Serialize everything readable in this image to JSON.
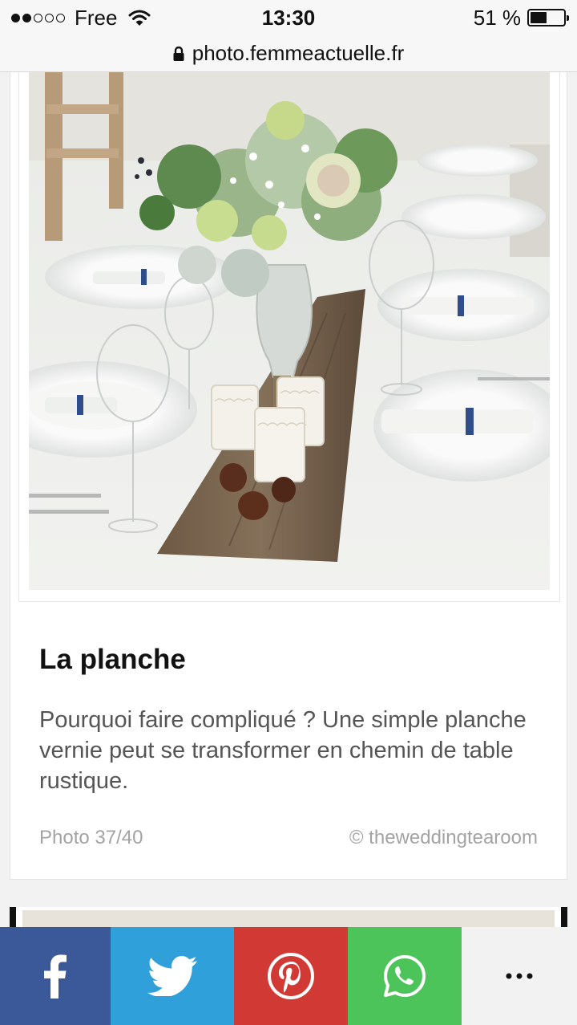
{
  "status_bar": {
    "carrier": "Free",
    "time": "13:30",
    "battery": "51 %",
    "battery_level": 0.51
  },
  "url_bar": {
    "url": "photo.femmeactuelle.fr",
    "icon": "lock-icon"
  },
  "card": {
    "image": "table-centerpiece-photo",
    "title": "La planche",
    "description": "Pourquoi faire compliqué ? Une simple planche vernie peut se transformer en chemin de table rustique.",
    "photo_count": "Photo 37/40",
    "credit": "© theweddingtearoom"
  },
  "share_bar": {
    "items": [
      {
        "name": "facebook",
        "icon": "facebook-icon",
        "color": "#3b5998"
      },
      {
        "name": "twitter",
        "icon": "twitter-icon",
        "color": "#2fa0da"
      },
      {
        "name": "pinterest",
        "icon": "pinterest-icon",
        "color": "#d13a34"
      },
      {
        "name": "whatsapp",
        "icon": "whatsapp-icon",
        "color": "#4dc45a"
      },
      {
        "name": "more",
        "icon": "more-icon",
        "color": "#f2f2f2"
      }
    ]
  }
}
